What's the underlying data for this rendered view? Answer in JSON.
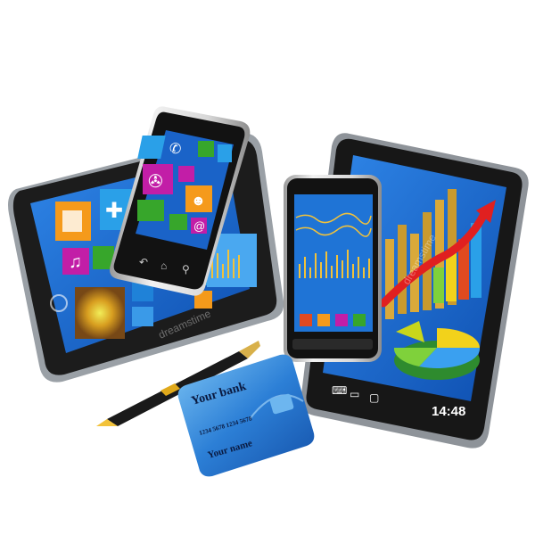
{
  "card": {
    "bank_name": "Your bank",
    "number": "1234 5678 1234 5678",
    "holder": "Your name"
  },
  "tablet_right": {
    "clock": "14:48"
  },
  "watermark": {
    "text": "dreamstime"
  },
  "colors": {
    "screen_blue": "#1a63c8",
    "device_black": "#1b1b1b",
    "tile_orange": "#f59a1b",
    "tile_magenta": "#c21ea7",
    "tile_purple": "#7a2fd0",
    "tile_green": "#37a62b",
    "tile_sky": "#2aa0e8",
    "chart_red": "#e02020",
    "card_blue": "#2c7fd6"
  }
}
